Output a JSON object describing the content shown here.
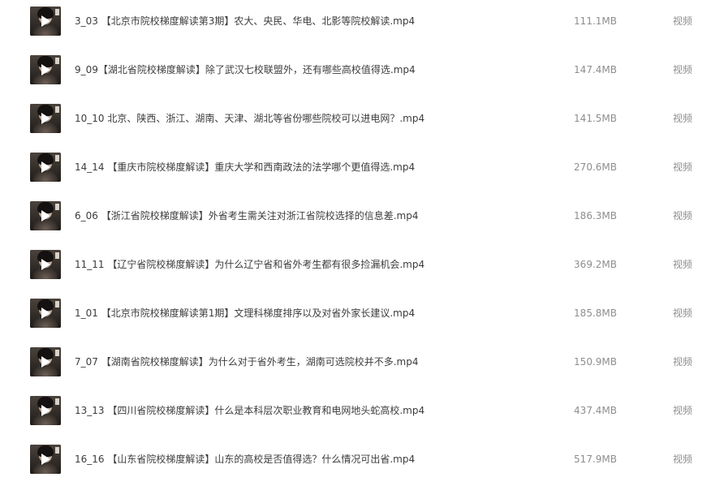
{
  "files": [
    {
      "name": "3_03 【北京市院校梯度解读第3期】农大、央民、华电、北影等院校解读.mp4",
      "size": "111.1MB",
      "type": "视频",
      "thumbnail_icon": "video-thumbnail-icon",
      "play_icon": "play-icon"
    },
    {
      "name": "9_09【湖北省院校梯度解读】除了武汉七校联盟外，还有哪些高校值得选.mp4",
      "size": "147.4MB",
      "type": "视频",
      "thumbnail_icon": "video-thumbnail-icon",
      "play_icon": "play-icon"
    },
    {
      "name": "10_10 北京、陕西、浙江、湖南、天津、湖北等省份哪些院校可以进电网？.mp4",
      "size": "141.5MB",
      "type": "视频",
      "thumbnail_icon": "video-thumbnail-icon",
      "play_icon": "play-icon"
    },
    {
      "name": "14_14 【重庆市院校梯度解读】重庆大学和西南政法的法学哪个更值得选.mp4",
      "size": "270.6MB",
      "type": "视频",
      "thumbnail_icon": "video-thumbnail-icon",
      "play_icon": "play-icon"
    },
    {
      "name": "6_06 【浙江省院校梯度解读】外省考生需关注对浙江省院校选择的信息差.mp4",
      "size": "186.3MB",
      "type": "视频",
      "thumbnail_icon": "video-thumbnail-icon",
      "play_icon": "play-icon"
    },
    {
      "name": "11_11 【辽宁省院校梯度解读】为什么辽宁省和省外考生都有很多捡漏机会.mp4",
      "size": "369.2MB",
      "type": "视频",
      "thumbnail_icon": "video-thumbnail-icon",
      "play_icon": "play-icon"
    },
    {
      "name": "1_01 【北京市院校梯度解读第1期】文理科梯度排序以及对省外家长建议.mp4",
      "size": "185.8MB",
      "type": "视频",
      "thumbnail_icon": "video-thumbnail-icon",
      "play_icon": "play-icon"
    },
    {
      "name": "7_07 【湖南省院校梯度解读】为什么对于省外考生，湖南可选院校并不多.mp4",
      "size": "150.9MB",
      "type": "视频",
      "thumbnail_icon": "video-thumbnail-icon",
      "play_icon": "play-icon"
    },
    {
      "name": "13_13 【四川省院校梯度解读】什么是本科层次职业教育和电网地头蛇高校.mp4",
      "size": "437.4MB",
      "type": "视频",
      "thumbnail_icon": "video-thumbnail-icon",
      "play_icon": "play-icon"
    },
    {
      "name": "16_16 【山东省院校梯度解读】山东的高校是否值得选？什么情况可出省.mp4",
      "size": "517.9MB",
      "type": "视频",
      "thumbnail_icon": "video-thumbnail-icon",
      "play_icon": "play-icon"
    }
  ]
}
